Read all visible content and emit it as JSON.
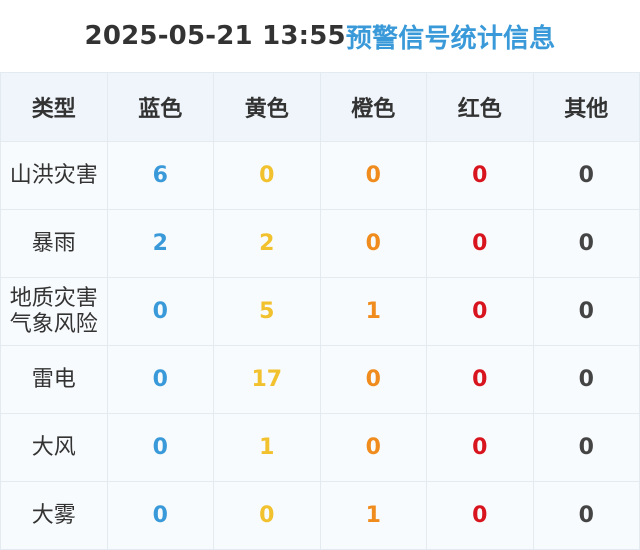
{
  "header": {
    "datetime": "2025-05-21 13:55",
    "title": "预警信号统计信息"
  },
  "colors": {
    "blue": "#3a9ad9",
    "yellow": "#f2c12e",
    "orange": "#f08c1e",
    "red": "#d8141e",
    "other": "#444444",
    "header_bg": "#eff5fa"
  },
  "table": {
    "columns": [
      "类型",
      "蓝色",
      "黄色",
      "橙色",
      "红色",
      "其他"
    ],
    "rows": [
      {
        "type": [
          "山洪灾害"
        ],
        "values": [
          "6",
          "0",
          "0",
          "0",
          "0"
        ]
      },
      {
        "type": [
          "暴雨"
        ],
        "values": [
          "2",
          "2",
          "0",
          "0",
          "0"
        ]
      },
      {
        "type": [
          "地质灾害",
          "气象风险"
        ],
        "values": [
          "0",
          "5",
          "1",
          "0",
          "0"
        ]
      },
      {
        "type": [
          "雷电"
        ],
        "values": [
          "0",
          "17",
          "0",
          "0",
          "0"
        ]
      },
      {
        "type": [
          "大风"
        ],
        "values": [
          "0",
          "1",
          "0",
          "0",
          "0"
        ]
      },
      {
        "type": [
          "大雾"
        ],
        "values": [
          "0",
          "0",
          "1",
          "0",
          "0"
        ]
      }
    ]
  }
}
